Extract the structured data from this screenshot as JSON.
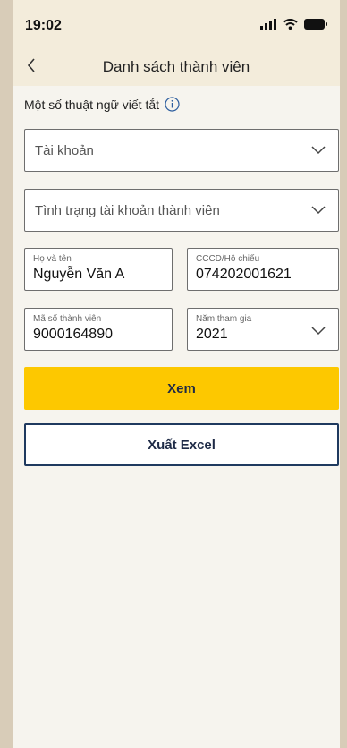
{
  "status_bar": {
    "time": "19:02"
  },
  "nav": {
    "title": "Danh sách thành viên"
  },
  "abbreviations": {
    "label": "Một số thuật ngữ viết tắt"
  },
  "filters": {
    "account_select": "Tài khoản",
    "status_select": "Tình trạng tài khoản thành viên"
  },
  "fields": {
    "full_name": {
      "label": "Họ và tên",
      "value": "Nguyễn Văn A"
    },
    "id_number": {
      "label": "CCCD/Hộ chiếu",
      "value": "074202001621"
    },
    "member_id": {
      "label": "Mã số thành viên",
      "value": "9000164890"
    },
    "join_year": {
      "label": "Năm tham gia",
      "value": "2021"
    }
  },
  "buttons": {
    "view": "Xem",
    "export": "Xuất Excel"
  },
  "colors": {
    "accent_yellow": "#fdc800",
    "navy": "#1f3a5f",
    "header_bg": "#f3ecdb"
  }
}
